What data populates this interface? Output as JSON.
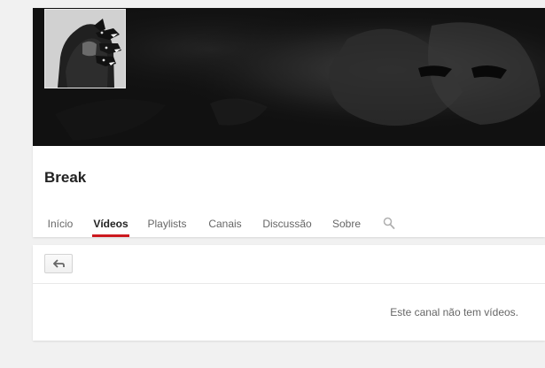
{
  "channel": {
    "title": "Break"
  },
  "tabs": [
    {
      "label": "Início"
    },
    {
      "label": "Vídeos"
    },
    {
      "label": "Playlists"
    },
    {
      "label": "Canais"
    },
    {
      "label": "Discussão"
    },
    {
      "label": "Sobre"
    }
  ],
  "icons": {
    "search": "search-icon",
    "back": "back-arrow-icon"
  },
  "content": {
    "empty_message": "Este canal não tem vídeos."
  },
  "colors": {
    "active_tab_underline": "#cc181e",
    "page_background": "#f1f1f1",
    "card_background": "#ffffff",
    "banner_background": "#161616"
  }
}
